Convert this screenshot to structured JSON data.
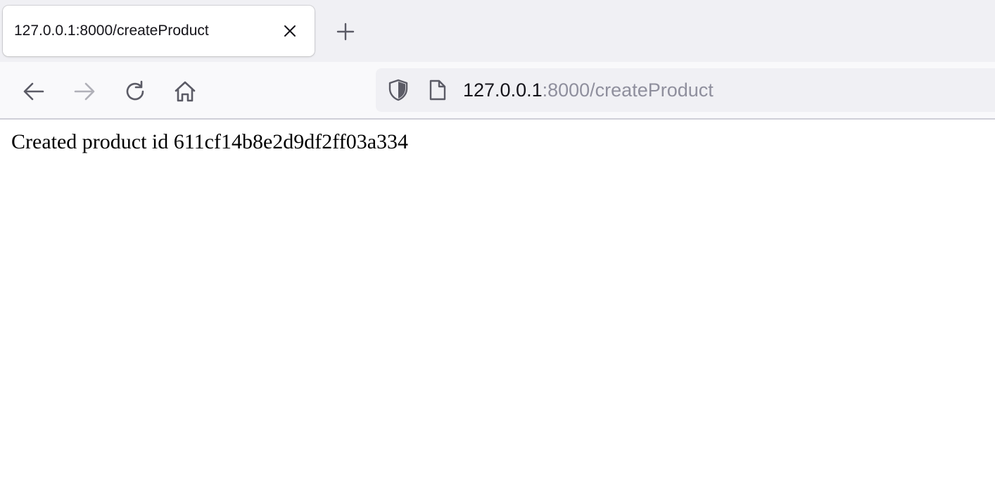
{
  "tab": {
    "title": "127.0.0.1:8000/createProduct"
  },
  "urlbar": {
    "host": "127.0.0.1",
    "rest": ":8000/createProduct"
  },
  "content": {
    "message": "Created product id 611cf14b8e2d9df2ff03a334"
  },
  "icons": {
    "tab_close": "close-icon",
    "new_tab": "plus-icon",
    "back": "arrow-left-icon",
    "forward": "arrow-right-icon",
    "reload": "reload-icon",
    "home": "home-icon",
    "tracking": "shield-icon",
    "page": "page-icon"
  },
  "colors": {
    "tabstrip_bg": "#f0f0f4",
    "navbar_bg": "#f9f9fb",
    "urlbar_bg": "#f0f0f4",
    "icon": "#5b5b66",
    "icon_disabled": "#b0b0b8",
    "url_host": "#15141a",
    "url_rest": "#8f8f9d"
  }
}
